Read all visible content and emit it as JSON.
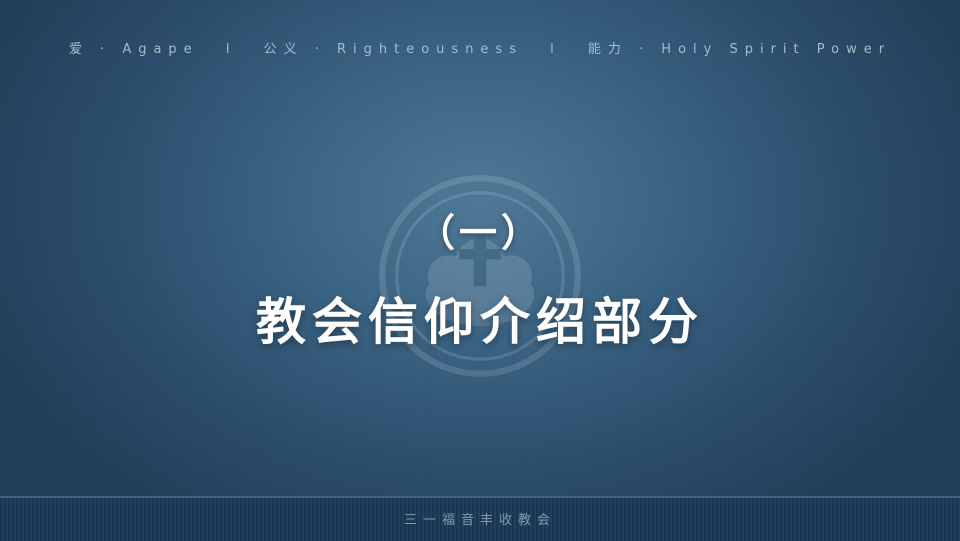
{
  "header": {
    "tagline_parts": [
      "爱 · Agape",
      "公义 · Righteousness",
      "能力 · Holy Spirit Power"
    ],
    "separator": "l"
  },
  "main": {
    "subtitle": "（一）",
    "title": "教会信仰介绍部分"
  },
  "footer": {
    "church_name": "三一福音丰收教会"
  },
  "colors": {
    "background_center": "#4e7896",
    "background_edge": "#223f59",
    "text_primary": "#ffffff",
    "text_muted": "#a9bccb",
    "footer_bg": "#1b3550"
  },
  "icons": {
    "watermark": "church-logo-watermark"
  }
}
